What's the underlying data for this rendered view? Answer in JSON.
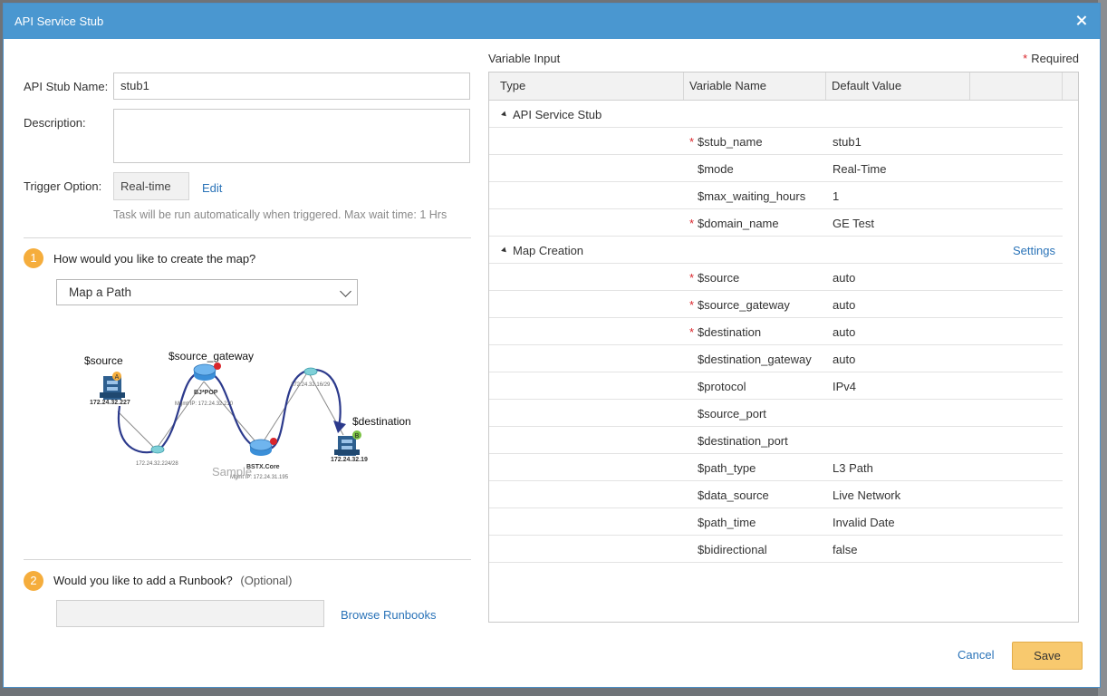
{
  "dialog": {
    "title": "API Service Stub"
  },
  "form": {
    "stub_name_label": "API Stub Name:",
    "stub_name_value": "stub1",
    "description_label": "Description:",
    "description_value": "",
    "trigger_label": "Trigger Option:",
    "trigger_value": "Real-time",
    "edit_link": "Edit",
    "trigger_hint": "Task will be run automatically when triggered. Max wait time: 1 Hrs"
  },
  "step1": {
    "number": "1",
    "title": "How would you like to create the map?",
    "selected_option": "Map a Path"
  },
  "diagram": {
    "source_label": "$source",
    "source_ip": "172.24.32.227",
    "gateway_label": "$source_gateway",
    "gateway_device": "BJ*POP",
    "gateway_mgmt": "Mgmt IP: 172.24.32.210",
    "core_device": "BSTX.Core",
    "core_mgmt": "Mgmt IP: 172.24.31.195",
    "link1_ip": "172.24.32.224/28",
    "link2_ip": "172.24.32.16/29",
    "destination_label": "$destination",
    "destination_ip": "172.24.32.19",
    "badge_a": "A",
    "badge_b": "B",
    "sample_label": "Sample"
  },
  "step2": {
    "number": "2",
    "title": "Would you like to add a Runbook?",
    "optional": "(Optional)",
    "browse_link": "Browse Runbooks"
  },
  "variables": {
    "title": "Variable Input",
    "required_label": "Required",
    "columns": [
      "Type",
      "Variable Name",
      "Default Value"
    ],
    "group1": "API Service Stub",
    "group1_rows": [
      {
        "name": "$stub_name",
        "value": "stub1",
        "required": true
      },
      {
        "name": "$mode",
        "value": "Real-Time",
        "required": false
      },
      {
        "name": "$max_waiting_hours",
        "value": "1",
        "required": false
      },
      {
        "name": "$domain_name",
        "value": "GE Test",
        "required": true
      }
    ],
    "group2": "Map Creation",
    "settings_link": "Settings",
    "group2_rows": [
      {
        "name": "$source",
        "value": "auto",
        "required": true
      },
      {
        "name": "$source_gateway",
        "value": "auto",
        "required": true
      },
      {
        "name": "$destination",
        "value": "auto",
        "required": true
      },
      {
        "name": "$destination_gateway",
        "value": "auto",
        "required": false
      },
      {
        "name": "$protocol",
        "value": "IPv4",
        "required": false
      },
      {
        "name": "$source_port",
        "value": "",
        "required": false
      },
      {
        "name": "$destination_port",
        "value": "",
        "required": false
      },
      {
        "name": "$path_type",
        "value": "L3 Path",
        "required": false
      },
      {
        "name": "$data_source",
        "value": "Live Network",
        "required": false
      },
      {
        "name": "$path_time",
        "value": "Invalid Date",
        "required": false
      },
      {
        "name": "$bidirectional",
        "value": "false",
        "required": false
      }
    ]
  },
  "footer": {
    "cancel": "Cancel",
    "save": "Save"
  },
  "colors": {
    "titlebar": "#4a97d0",
    "step_badge": "#f5ad3c",
    "save_button": "#f8c96e",
    "link": "#2a73b8",
    "required_star": "#d9252b"
  }
}
